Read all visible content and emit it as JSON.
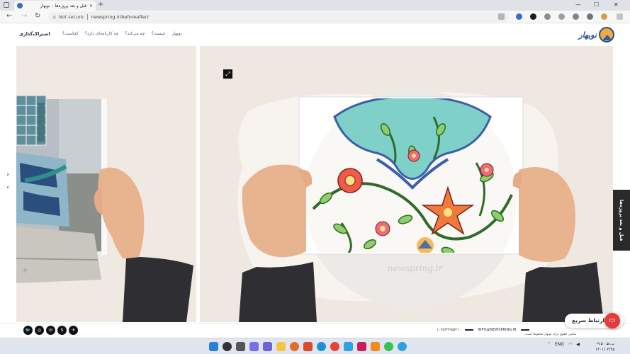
{
  "browser": {
    "tab_title": "قبل و بعد پروژه‌ها – نوبهار",
    "tab_close": "✕",
    "new_tab": "+",
    "security_label": "Not secure",
    "url": "newspring.ir/beforeafter/",
    "window_minimize": "—",
    "window_maximize": "☐",
    "window_close": "✕"
  },
  "header": {
    "subscribe": "اشتراک‌گذاری",
    "menu": [
      "نوبهار",
      "چیست؟",
      "چه می‌کند؟",
      "چه کارنامه‌ای دارد؟",
      "کجاست؟"
    ],
    "logo_text": "نوبهار"
  },
  "gallery": {
    "left_arrow_up": "›",
    "left_arrow_down": "‹",
    "expand_icon": "⤢",
    "side_tab": "قبل و بعد پروژه‌ها",
    "watermark": "newspring.ir",
    "left_watermark": "ir"
  },
  "footer": {
    "social": [
      "twitter-icon",
      "instagram-icon",
      "whatsapp-icon",
      "skype-icon",
      "telegram-icon"
    ],
    "social_glyphs": [
      "🐦",
      "◎",
      "☏",
      "S",
      "✈"
    ],
    "phone": "(۰۲۵)۳۲۹۵۵۴۱۰",
    "email": "INFO@NEWSPRING.IR",
    "copyright": "تمامی حقوق برای نوبهار محفوظ است.",
    "quick_contact": "ارتباط سریع"
  },
  "taskbar": {
    "language": "ENG",
    "time": "۰۹:۵۰ ب.ظ",
    "date": "۱۴۰۱/۰۲/۲۵"
  },
  "colors": {
    "panel_bg": "#efe8e1",
    "accent_red": "#e63b3b",
    "logo_blue": "#264f8d",
    "logo_orange": "#f2a93b"
  }
}
